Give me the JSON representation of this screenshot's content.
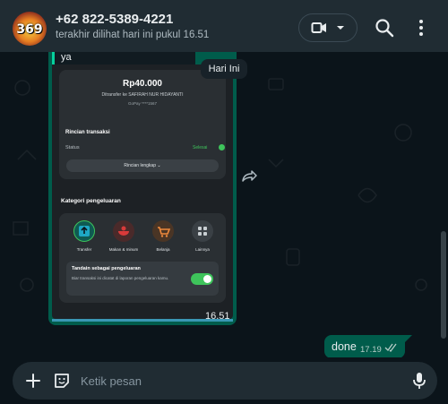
{
  "header": {
    "avatar_text": "369",
    "contact_name": "+62 822-5389-4221",
    "contact_status": "terakhir dilihat hari ini pukul 16.51"
  },
  "chat": {
    "date_divider": "Hari Ini",
    "image_message": {
      "caption_top": "ya",
      "time": "16.51",
      "receipt": {
        "amount": "Rp40.000",
        "recipient": "Ditransfer ke SAFIRAH NUR HIDAYANTI",
        "account": "GoPay ****1567",
        "section_title": "Rincian transaksi",
        "status_label": "Status",
        "status_value": "Selesai",
        "details_button": "Rincian lengkap",
        "category_title": "Kategori pengeluaran",
        "categories": [
          {
            "label": "Transfer"
          },
          {
            "label": "Makan & minum"
          },
          {
            "label": "Belanja"
          },
          {
            "label": "Lainnya"
          }
        ],
        "mark_title": "Tandain sebagai pengeluaran",
        "mark_desc": "Biar transaksi ini dicatat di laporan pengeluaran kamu."
      }
    },
    "outgoing_message": {
      "text": "done",
      "time": "17.19"
    }
  },
  "composer": {
    "placeholder": "Ketik pesan"
  },
  "colors": {
    "header_bg": "#202c33",
    "chat_bg": "#0b141a",
    "outgoing_bubble": "#005c4b",
    "accent_green": "#06cf9c"
  },
  "icons": [
    "video-call-icon",
    "chevron-down-icon",
    "search-icon",
    "menu-dots-icon",
    "forward-icon",
    "plus-icon",
    "sticker-icon",
    "mic-icon",
    "double-check-icon"
  ]
}
